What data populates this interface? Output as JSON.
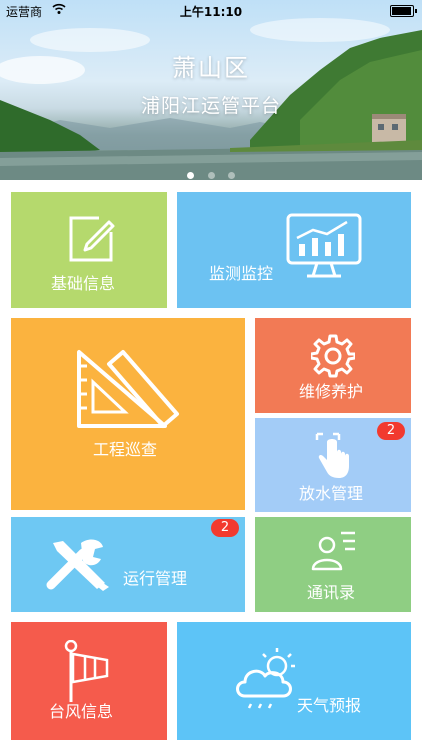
{
  "status_bar": {
    "carrier": "运营商",
    "time": "上午11:10"
  },
  "banner": {
    "title": "萧山区",
    "subtitle": "浦阳江运管平台",
    "page_count": 3,
    "active_page": 1
  },
  "tiles": {
    "basic_info": {
      "label": "基础信息",
      "icon": "edit-icon",
      "color": "#b5d96d"
    },
    "monitoring": {
      "label": "监测监控",
      "icon": "monitor-chart-icon",
      "color": "#6cc2f2"
    },
    "inspection": {
      "label": "工程巡查",
      "icon": "ruler-triangle-icon",
      "color": "#fbb33f"
    },
    "maintenance": {
      "label": "维修养护",
      "icon": "gear-icon",
      "color": "#f27a55"
    },
    "water_release": {
      "label": "放水管理",
      "icon": "touch-hand-icon",
      "color": "#a3ccf7",
      "badge": "2"
    },
    "operation": {
      "label": "运行管理",
      "icon": "tools-icon",
      "color": "#6ec8f3",
      "badge": "2"
    },
    "contacts": {
      "label": "通讯录",
      "icon": "contacts-icon",
      "color": "#8fce83"
    },
    "typhoon": {
      "label": "台风信息",
      "icon": "windsock-icon",
      "color": "#f55b4c"
    },
    "weather": {
      "label": "天气预报",
      "icon": "weather-icon",
      "color": "#5dc4f7"
    }
  }
}
